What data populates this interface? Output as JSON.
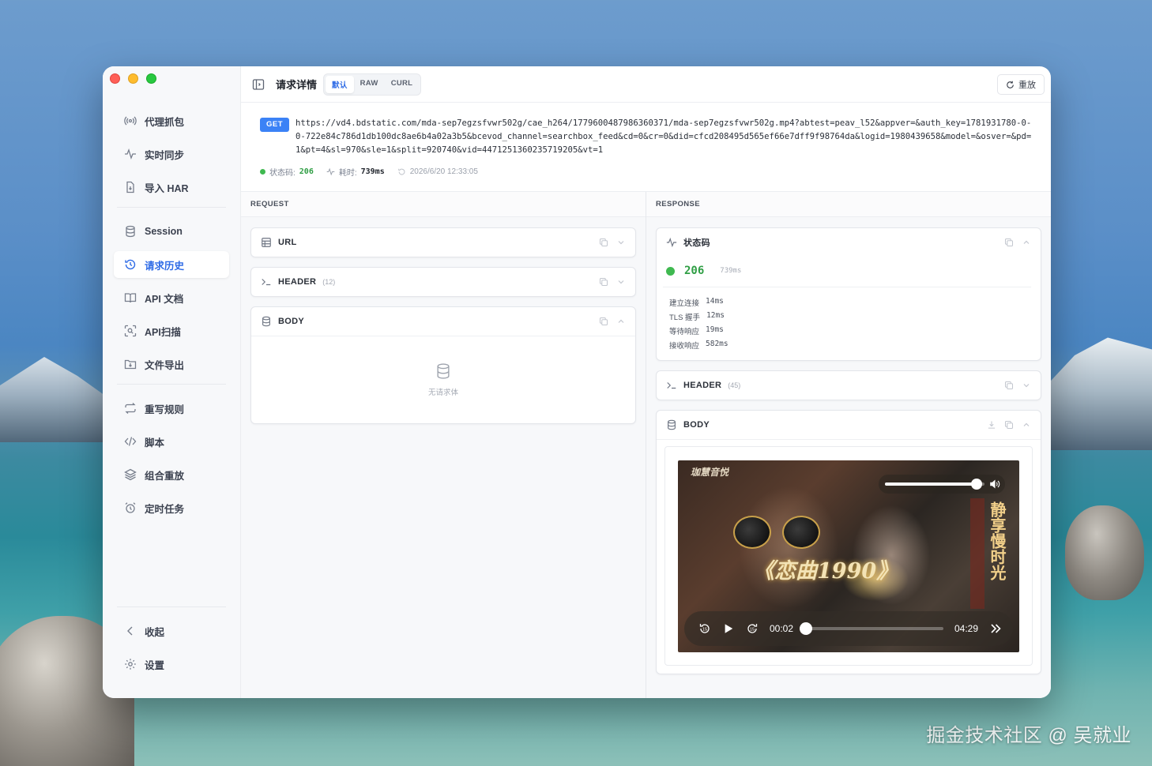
{
  "watermark": "掘金技术社区 @ 吴就业",
  "sidebar": {
    "items_top": [
      {
        "label": "代理抓包",
        "icon": "broadcast-icon"
      },
      {
        "label": "实时同步",
        "icon": "activity-icon"
      },
      {
        "label": "导入 HAR",
        "icon": "file-import-icon"
      }
    ],
    "items_mid": [
      {
        "label": "Session",
        "icon": "database-icon"
      },
      {
        "label": "请求历史",
        "icon": "history-icon",
        "active": true
      },
      {
        "label": "API 文档",
        "icon": "book-icon"
      },
      {
        "label": "API扫描",
        "icon": "scan-icon"
      },
      {
        "label": "文件导出",
        "icon": "folder-export-icon"
      }
    ],
    "items_tools": [
      {
        "label": "重写规则",
        "icon": "repeat-icon"
      },
      {
        "label": "脚本",
        "icon": "code-icon"
      },
      {
        "label": "组合重放",
        "icon": "layers-icon"
      },
      {
        "label": "定时任务",
        "icon": "alarm-icon"
      }
    ],
    "items_bottom": [
      {
        "label": "收起",
        "icon": "chevron-left-icon"
      },
      {
        "label": "设置",
        "icon": "gear-icon"
      }
    ]
  },
  "header": {
    "title": "请求详情",
    "tabs": [
      "默认",
      "RAW",
      "CURL"
    ],
    "active_tab": "默认",
    "replay_label": "重放"
  },
  "request": {
    "method": "GET",
    "url": "https://vd4.bdstatic.com/mda-sep7egzsfvwr502g/cae_h264/1779600487986360371/mda-sep7egzsfvwr502g.mp4?abtest=peav_l52&appver=&auth_key=1781931780-0-0-722e84c786d1db100dc8ae6b4a02a3b5&bcevod_channel=searchbox_feed&cd=0&cr=0&did=cfcd208495d565ef66e7dff9f98764da&logid=1980439658&model=&osver=&pd=1&pt=4&sl=970&sle=1&split=920740&vid=4471251360235719205&vt=1",
    "status_label": "状态码:",
    "status_code": "206",
    "duration_label": "耗时:",
    "duration": "739ms",
    "timestamp": "2026/6/20 12:33:05"
  },
  "left_pane": {
    "title": "REQUEST",
    "url_card": "URL",
    "header_card": "HEADER",
    "header_count": "(12)",
    "body_card": "BODY",
    "body_empty": "无请求体"
  },
  "right_pane": {
    "title": "RESPONSE",
    "status_card": "状态码",
    "status_code": "206",
    "status_ms": "739ms",
    "timing": [
      {
        "label": "建立连接",
        "value": "14ms"
      },
      {
        "label": "TLS 握手",
        "value": "12ms"
      },
      {
        "label": "等待响应",
        "value": "19ms"
      },
      {
        "label": "接收响应",
        "value": "582ms"
      }
    ],
    "header_card": "HEADER",
    "header_count": "(45)",
    "body_card": "BODY"
  },
  "video": {
    "brand_text": "珈慧音悦",
    "song_text": "《恋曲1990》",
    "side_text": "静享慢时光",
    "current_time": "00:02",
    "total_time": "04:29",
    "progress_fraction": 0.01,
    "volume_fraction": 0.92
  }
}
